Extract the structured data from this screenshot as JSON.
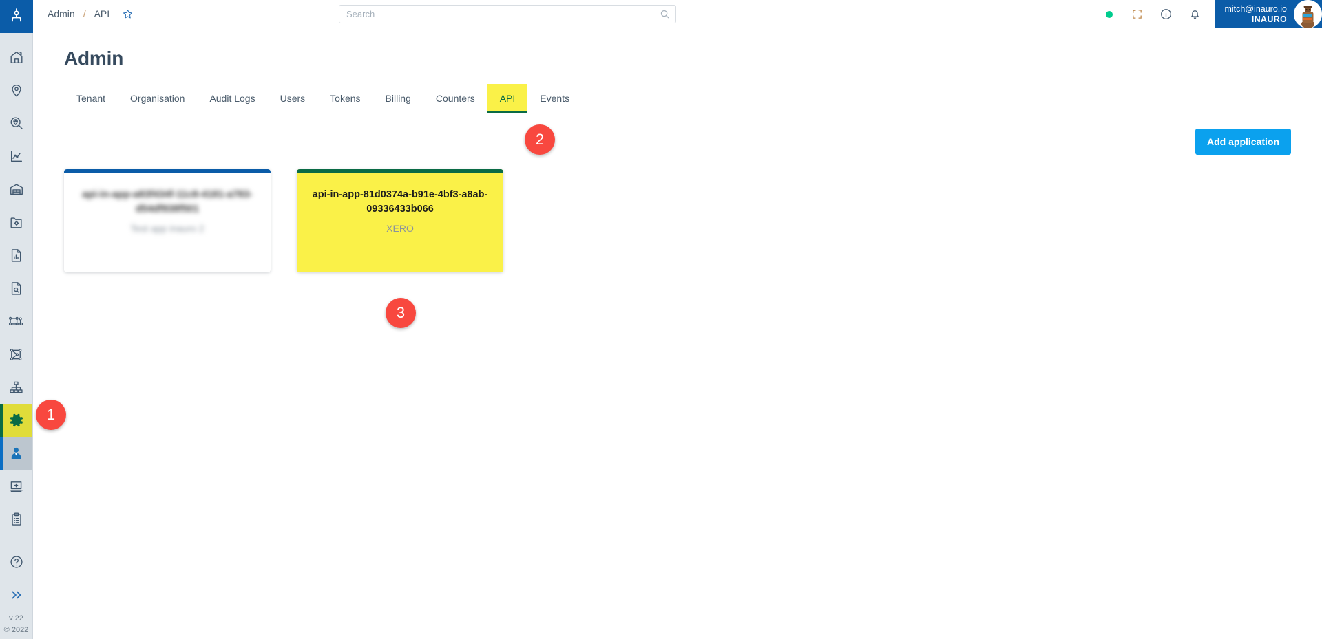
{
  "brand": {
    "logo_icon": "network-hierarchy-logo-icon",
    "primary_blue": "#0b5ca8",
    "accent_blue": "#0ba1ee",
    "highlight_yellow": "#faf148",
    "accent_green": "#0a6b45",
    "marker_red": "#f8483f",
    "status_green": "#00cc8e"
  },
  "topbar": {
    "breadcrumb": {
      "root": "Admin",
      "separator": "/",
      "current": "API",
      "favourite_icon": "star-icon"
    },
    "search": {
      "value": "",
      "placeholder": "Search",
      "icon": "search-icon"
    },
    "status_indicator": "online-status-dot",
    "icons": [
      {
        "name": "fullscreen-icon",
        "label": "Fullscreen"
      },
      {
        "name": "info-icon",
        "label": "Information"
      },
      {
        "name": "bell-icon",
        "label": "Notifications"
      }
    ],
    "user": {
      "email": "mitch@inauro.io",
      "organisation": "INAURO",
      "avatar_icon": "user-avatar"
    }
  },
  "sidebar": {
    "items": [
      {
        "name": "sidebar-item-home",
        "icon": "home-icon",
        "label": "Home",
        "state": "default"
      },
      {
        "name": "sidebar-item-locations",
        "icon": "map-pin-icon",
        "label": "Locations",
        "state": "default"
      },
      {
        "name": "sidebar-item-find-location",
        "icon": "pin-search-icon",
        "label": "Find Location",
        "state": "default"
      },
      {
        "name": "sidebar-item-analytics",
        "icon": "line-chart-icon",
        "label": "Analytics",
        "state": "default"
      },
      {
        "name": "sidebar-item-sites",
        "icon": "warehouse-icon",
        "label": "Sites",
        "state": "default"
      },
      {
        "name": "sidebar-item-asset-config",
        "icon": "folder-gear-icon",
        "label": "Asset Config",
        "state": "default"
      },
      {
        "name": "sidebar-item-reports",
        "icon": "document-chart-icon",
        "label": "Reports",
        "state": "default"
      },
      {
        "name": "sidebar-item-document-search",
        "icon": "document-search-icon",
        "label": "Document Search",
        "state": "default"
      },
      {
        "name": "sidebar-item-workflows",
        "icon": "network-flow-icon",
        "label": "Workflows",
        "state": "default"
      },
      {
        "name": "sidebar-item-shapes",
        "icon": "shape-nodes-icon",
        "label": "Shapes",
        "state": "default"
      },
      {
        "name": "sidebar-item-hierarchy",
        "icon": "org-hierarchy-icon",
        "label": "Hierarchy",
        "state": "default"
      },
      {
        "name": "sidebar-item-settings",
        "icon": "gear-icon",
        "label": "Settings",
        "state": "active"
      },
      {
        "name": "sidebar-item-admin",
        "icon": "user-tie-icon",
        "label": "Admin",
        "state": "selected"
      },
      {
        "name": "sidebar-item-add-device",
        "icon": "laptop-plus-icon",
        "label": "Add Device",
        "state": "default"
      },
      {
        "name": "sidebar-item-tasks",
        "icon": "clipboard-list-icon",
        "label": "Tasks",
        "state": "default"
      }
    ],
    "bottom": [
      {
        "name": "sidebar-help",
        "icon": "help-circle-icon",
        "label": "Help"
      },
      {
        "name": "sidebar-expand",
        "icon": "chevron-double-right-icon",
        "label": "Expand"
      }
    ],
    "version": "v 22",
    "copyright": "© 2022"
  },
  "page": {
    "title": "Admin",
    "tabs": [
      {
        "name": "tab-tenant",
        "label": "Tenant",
        "active": false
      },
      {
        "name": "tab-organisation",
        "label": "Organisation",
        "active": false
      },
      {
        "name": "tab-audit-logs",
        "label": "Audit Logs",
        "active": false
      },
      {
        "name": "tab-users",
        "label": "Users",
        "active": false
      },
      {
        "name": "tab-tokens",
        "label": "Tokens",
        "active": false
      },
      {
        "name": "tab-billing",
        "label": "Billing",
        "active": false
      },
      {
        "name": "tab-counters",
        "label": "Counters",
        "active": false
      },
      {
        "name": "tab-api",
        "label": "API",
        "active": true
      },
      {
        "name": "tab-events",
        "label": "Events",
        "active": false
      }
    ],
    "add_application_label": "Add application",
    "applications": [
      {
        "name": "application-card-redacted",
        "id": "api-in-app-a83f434f-11c8-4181-a783-d54df938f501",
        "subtitle": "Test app inauro 2",
        "accent": "blue",
        "highlighted": false,
        "redacted": true
      },
      {
        "name": "application-card-xero",
        "id": "api-in-app-81d0374a-b91e-4bf3-a8ab-09336433b066",
        "subtitle": "XERO",
        "accent": "green",
        "highlighted": true,
        "redacted": false
      }
    ]
  },
  "annotations": [
    {
      "name": "annotation-marker-1",
      "label": "1"
    },
    {
      "name": "annotation-marker-2",
      "label": "2"
    },
    {
      "name": "annotation-marker-3",
      "label": "3"
    }
  ]
}
